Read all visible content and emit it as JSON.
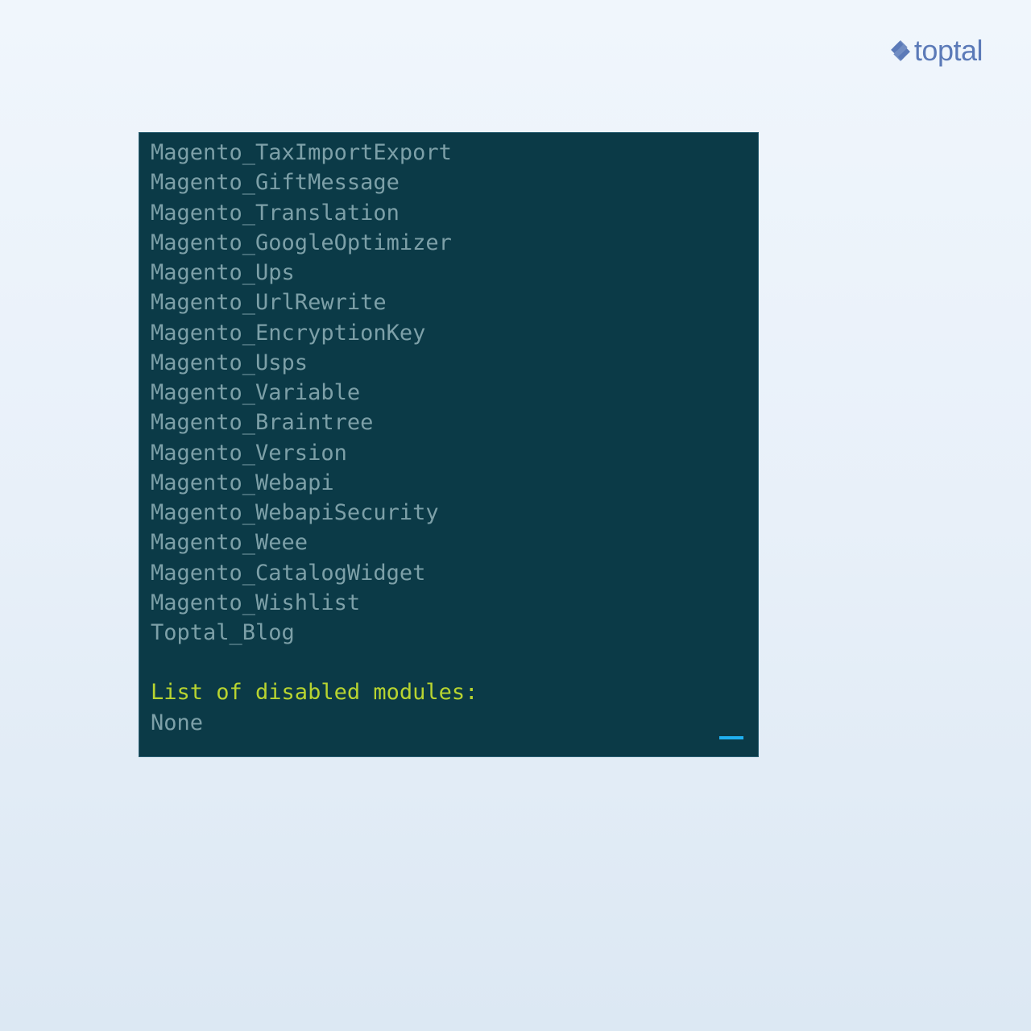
{
  "logo": {
    "text": "toptal"
  },
  "terminal": {
    "modules": [
      "Magento_TaxImportExport",
      "Magento_GiftMessage",
      "Magento_Translation",
      "Magento_GoogleOptimizer",
      "Magento_Ups",
      "Magento_UrlRewrite",
      "Magento_EncryptionKey",
      "Magento_Usps",
      "Magento_Variable",
      "Magento_Braintree",
      "Magento_Version",
      "Magento_Webapi",
      "Magento_WebapiSecurity",
      "Magento_Weee",
      "Magento_CatalogWidget",
      "Magento_Wishlist",
      "Toptal_Blog"
    ],
    "disabled_heading": "List of disabled modules:",
    "disabled_value": "None"
  }
}
